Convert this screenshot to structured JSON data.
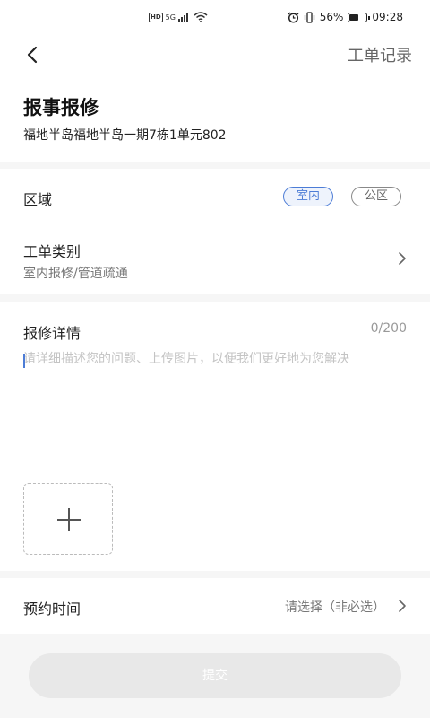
{
  "status_bar": {
    "hd": "HD",
    "network": "5G",
    "battery_percent": "56%",
    "battery_level": 0.56,
    "time": "09:28"
  },
  "header": {
    "records_label": "工单记录",
    "title": "报事报修",
    "address": "福地半岛福地半岛一期7栋1单元802"
  },
  "area": {
    "label": "区域",
    "options": [
      "室内",
      "公区"
    ],
    "selected": "室内"
  },
  "category": {
    "label": "工单类别",
    "value": "室内报修/管道疏通"
  },
  "details": {
    "label": "报修详情",
    "counter": "0/200",
    "placeholder": "请详细描述您的问题、上传图片，以便我们更好地为您解决"
  },
  "appointment": {
    "label": "预约时间",
    "placeholder": "请选择（非必选）"
  },
  "submit_label": "提交",
  "colors": {
    "accent": "#4c7cd6",
    "submit_disabled": "#e8e8e8",
    "background": "#f6f6f6"
  }
}
